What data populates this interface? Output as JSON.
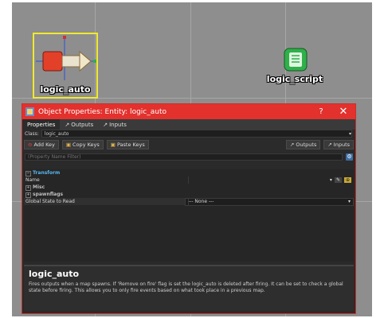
{
  "viewport": {
    "entities": [
      {
        "name": "logic_auto",
        "icon": "logic-auto-icon",
        "selected": true
      },
      {
        "name": "logic_script",
        "icon": "logic-script-icon",
        "selected": false
      }
    ]
  },
  "dialog": {
    "title": "Object Properties: Entity: logic_auto",
    "help": "?",
    "close": "✕",
    "tabs": [
      {
        "label": "Properties",
        "icon": ""
      },
      {
        "label": "Outputs",
        "icon": "output-arrow-icon"
      },
      {
        "label": "Inputs",
        "icon": "input-arrow-icon"
      }
    ],
    "class_label": "Class:",
    "class_value": "logic_auto",
    "buttons": {
      "add_key": "Add Key",
      "copy_keys": "Copy Keys",
      "paste_keys": "Paste Keys",
      "outputs": "Outputs",
      "inputs": "Inputs"
    },
    "filter_placeholder": "(Property Name Filter)",
    "properties": {
      "group_transform": "Transform",
      "name_label": "Name",
      "group_misc": "Misc",
      "group_spawnflags": "spawnflags",
      "global_state_label": "Global State to Read",
      "global_state_value": "--- None ---"
    },
    "description": {
      "title": "logic_auto",
      "text": "Fires outputs when a map spawns. If 'Remove on fire' flag is set the logic_auto is deleted after firing. It can be set to check a global state before firing. This allows you to only fire events based on what took place in a previous map."
    }
  },
  "colors": {
    "titlebar": "#e3312d",
    "selection": "#f0ea2c",
    "transform_group": "#58b7f0",
    "viewport_bg": "#8e8e8e"
  }
}
